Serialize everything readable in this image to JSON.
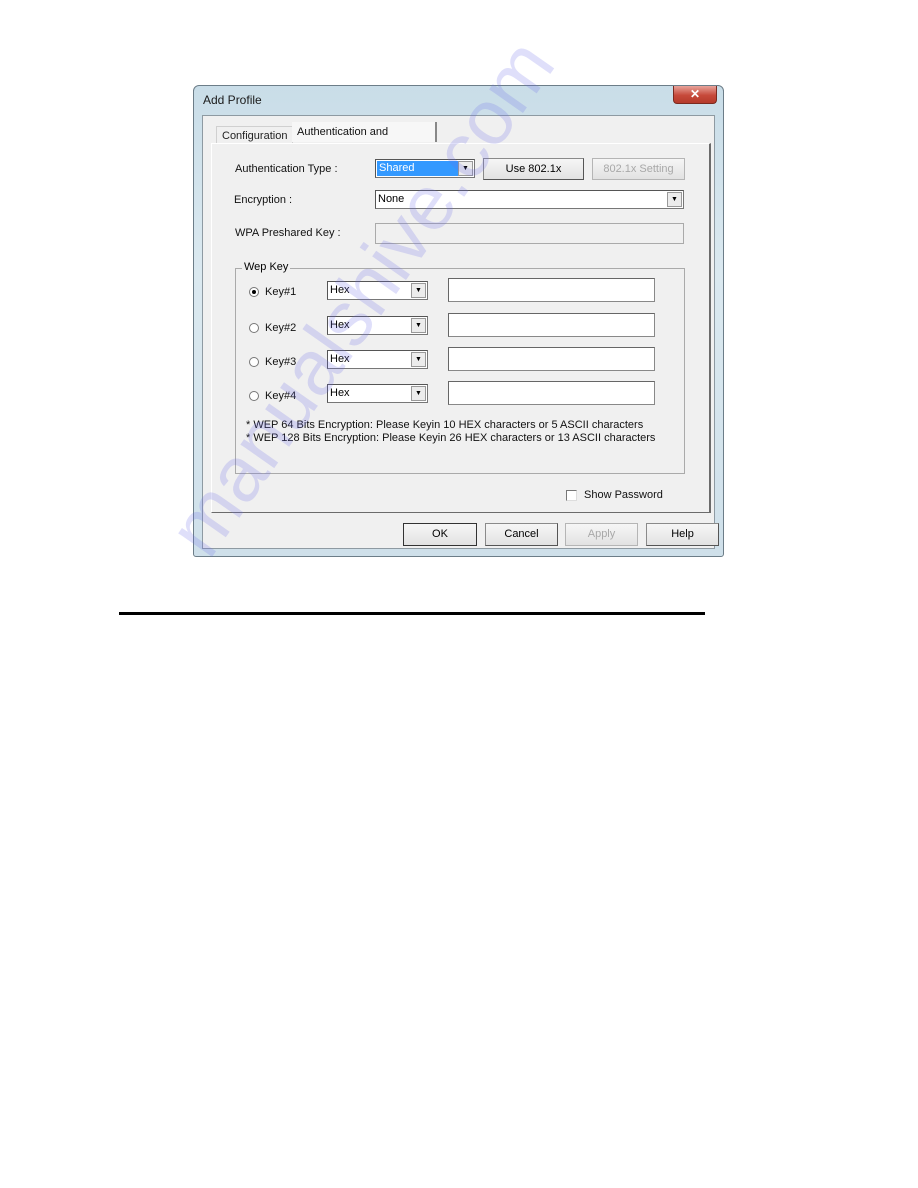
{
  "window": {
    "title": "Add Profile",
    "close_icon": "close-x-icon"
  },
  "tabs": [
    {
      "label": "Configuration",
      "active": false
    },
    {
      "label": "Authentication and Security",
      "active": true
    }
  ],
  "auth": {
    "auth_type_label": "Authentication Type :",
    "auth_type_value": "Shared",
    "use_8021x_label": "Use 802.1x",
    "setting_8021x_label": "802.1x Setting",
    "encryption_label": "Encryption :",
    "encryption_value": "None",
    "wpa_label": "WPA Preshared Key :",
    "wpa_value": ""
  },
  "wep": {
    "group_title": "Wep Key",
    "keys": [
      {
        "label": "Key#1",
        "format": "Hex",
        "value": "",
        "selected": true
      },
      {
        "label": "Key#2",
        "format": "Hex",
        "value": "",
        "selected": false
      },
      {
        "label": "Key#3",
        "format": "Hex",
        "value": "",
        "selected": false
      },
      {
        "label": "Key#4",
        "format": "Hex",
        "value": "",
        "selected": false
      }
    ],
    "notes": [
      "* WEP 64 Bits Encryption:  Please Keyin 10 HEX characters or 5 ASCII characters",
      "* WEP 128 Bits Encryption:  Please Keyin 26 HEX characters or 13 ASCII characters"
    ]
  },
  "show_password": {
    "label": "Show Password",
    "checked": false
  },
  "footer": {
    "ok": "OK",
    "cancel": "Cancel",
    "apply": "Apply",
    "help": "Help"
  },
  "watermark": "manualshive.com"
}
